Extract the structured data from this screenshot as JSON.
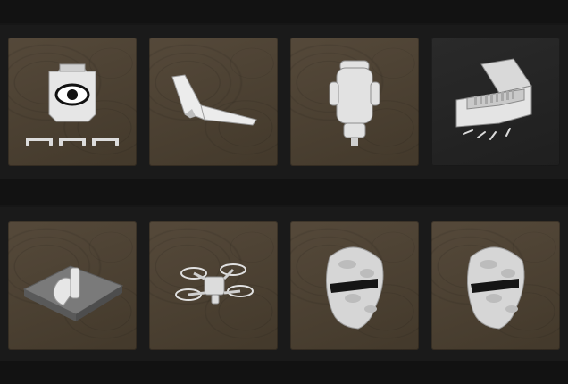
{
  "grid": {
    "rows": [
      {
        "items": [
          {
            "id": "vest-eye",
            "icon": "vest-with-eye-icon",
            "selected": false,
            "slots": 3
          },
          {
            "id": "stealth-drone",
            "icon": "stealth-wing-icon",
            "selected": false
          },
          {
            "id": "backpack",
            "icon": "backpack-icon",
            "selected": false
          },
          {
            "id": "ammo-case",
            "icon": "ammo-case-icon",
            "selected": true
          }
        ]
      },
      {
        "items": [
          {
            "id": "supply-crate",
            "icon": "supply-crate-icon",
            "selected": false
          },
          {
            "id": "quad-drone",
            "icon": "quadcopter-drone-icon",
            "selected": false
          },
          {
            "id": "balaclava-1",
            "icon": "camo-balaclava-icon",
            "selected": false
          },
          {
            "id": "balaclava-2",
            "icon": "camo-balaclava-icon",
            "selected": false
          }
        ]
      }
    ]
  },
  "colors": {
    "background": "#141414",
    "tile": "#4a4030",
    "tile_selected": "#242424",
    "item": "#e8e8e8"
  }
}
